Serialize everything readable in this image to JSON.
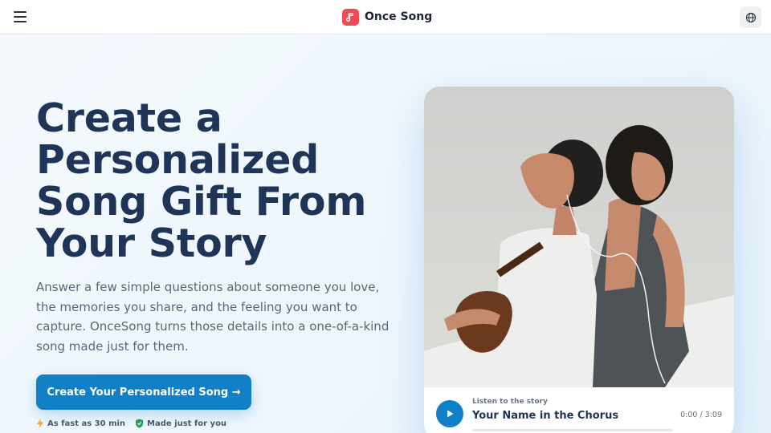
{
  "header": {
    "brand_name": "Once Song",
    "icons": {
      "menu": "hamburger-icon",
      "logo": "music-note-icon",
      "language": "globe-icon"
    },
    "brand_color": "#ee4b57"
  },
  "hero": {
    "title": "Create a Personalized Song Gift From Your Story",
    "description": "Answer a few simple questions about someone you love, the memories you share, and the feeling you want to capture. OnceSong turns those details into a one-of-a-kind song made just for them.",
    "cta_label": "Create Your Personalized Song →",
    "badges": [
      {
        "icon": "lightning-icon",
        "label": "As fast as 30 min"
      },
      {
        "icon": "shield-icon",
        "label": "Made just for you"
      }
    ],
    "accent_color": "#1180c6"
  },
  "player": {
    "eyebrow": "Listen to the story",
    "title": "Your Name in the Chorus",
    "time": "0:00 / 3:09",
    "progress": 0
  }
}
